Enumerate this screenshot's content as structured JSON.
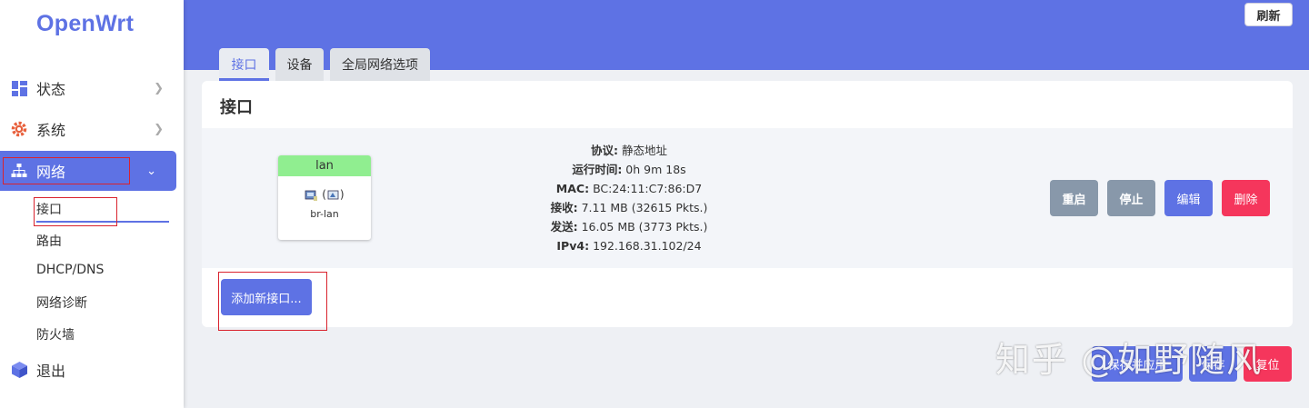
{
  "app": {
    "logo": "OpenWrt"
  },
  "sidebar": {
    "items": [
      {
        "label": "状态",
        "icon": "dashboard-icon"
      },
      {
        "label": "系统",
        "icon": "gear-icon"
      },
      {
        "label": "网络",
        "icon": "network-tree-icon"
      },
      {
        "label": "退出",
        "icon": "cube-icon"
      }
    ],
    "network_sub": [
      "接口",
      "路由",
      "DHCP/DNS",
      "网络诊断",
      "防火墙"
    ]
  },
  "header": {
    "refresh": "刷新"
  },
  "tabs": [
    {
      "label": "接口",
      "active": true
    },
    {
      "label": "设备",
      "active": false
    },
    {
      "label": "全局网络选项",
      "active": false
    }
  ],
  "card": {
    "title": "接口"
  },
  "interface": {
    "name": "lan",
    "device_icons": "(",
    "device_icons_close": ")",
    "device": "br-lan",
    "details": [
      {
        "label": "协议:",
        "value": "静态地址"
      },
      {
        "label": "运行时间:",
        "value": "0h 9m 18s"
      },
      {
        "label": "MAC:",
        "value": "BC:24:11:C7:86:D7"
      },
      {
        "label": "接收:",
        "value": "7.11 MB (32615 Pkts.)"
      },
      {
        "label": "发送:",
        "value": "16.05 MB (3773 Pkts.)"
      },
      {
        "label": "IPv4:",
        "value": "192.168.31.102/24"
      }
    ],
    "actions": {
      "restart": "重启",
      "stop": "停止",
      "edit": "编辑",
      "delete": "删除"
    }
  },
  "add_button": "添加新接口...",
  "footer": {
    "save_apply": "保存并应用",
    "save": "保存",
    "reset": "复位"
  },
  "watermark": "知乎 @如野随风",
  "colors": {
    "accent": "#5e72e4",
    "danger": "#f5365c",
    "muted": "#8898aa",
    "iface_green": "#90ee90"
  }
}
